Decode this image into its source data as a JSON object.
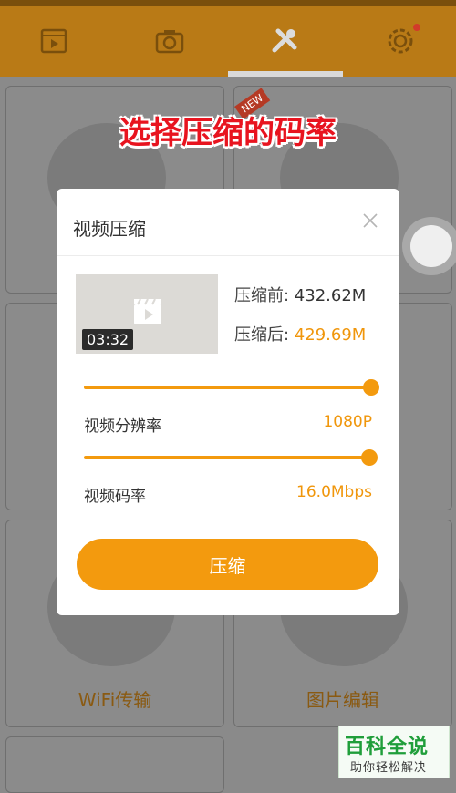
{
  "toolbar": {
    "tabs": [
      {
        "icon": "video-icon"
      },
      {
        "icon": "camera-icon"
      },
      {
        "icon": "tools-icon"
      },
      {
        "icon": "gear-icon"
      }
    ]
  },
  "overlay": {
    "caption": "选择压缩的码率"
  },
  "grid": {
    "badge": "NEW",
    "items": [
      {
        "label": ""
      },
      {
        "label": ""
      },
      {
        "label": ""
      },
      {
        "label": ""
      },
      {
        "label": "WiFi传输"
      },
      {
        "label": "图片编辑"
      }
    ]
  },
  "dialog": {
    "title": "视频压缩",
    "duration": "03:32",
    "before_label": "压缩前: ",
    "before_value": "432.62M",
    "after_label": "压缩后: ",
    "after_value": "429.69M",
    "resolution_label": "视频分辨率",
    "resolution_value": "1080P",
    "resolution_level": 1.0,
    "bitrate_label": "视频码率",
    "bitrate_value": "16.0Mbps",
    "bitrate_level": 1.0,
    "compress_button": "压缩"
  },
  "watermark": {
    "title": "百科全说",
    "subtitle": "助你轻松解决"
  },
  "colors": {
    "accent": "#f39a0e",
    "title_red": "#e8141f"
  }
}
